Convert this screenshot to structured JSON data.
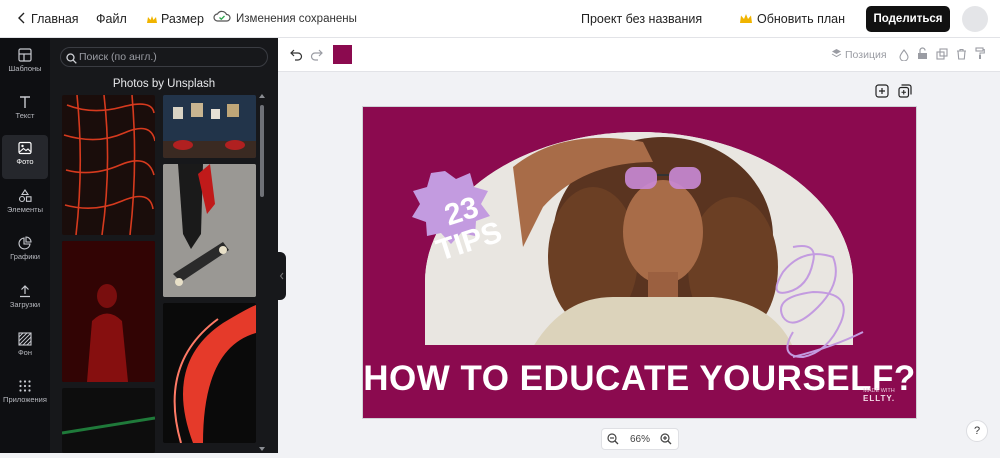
{
  "topbar": {
    "back_label": "Главная",
    "file_label": "Файл",
    "size_label": "Размер",
    "saved_label": "Изменения сохранены",
    "project_title": "Проект без названия",
    "upgrade_label": "Обновить план",
    "share_label": "Поделиться"
  },
  "rail": {
    "items": [
      {
        "label": "Шаблоны",
        "icon": "templates-icon"
      },
      {
        "label": "Текст",
        "icon": "text-icon"
      },
      {
        "label": "Фото",
        "icon": "photo-icon"
      },
      {
        "label": "Элементы",
        "icon": "elements-icon"
      },
      {
        "label": "Графики",
        "icon": "charts-icon"
      },
      {
        "label": "Загрузки",
        "icon": "upload-icon"
      },
      {
        "label": "Фон",
        "icon": "background-icon"
      },
      {
        "label": "Приложения",
        "icon": "apps-icon"
      }
    ],
    "active_index": 2
  },
  "panel": {
    "search_placeholder": "Поиск (по англ.)",
    "title": "Photos by Unsplash"
  },
  "toolbar": {
    "position_label": "Позиция",
    "current_color": "#8b0a4f"
  },
  "canvas": {
    "badge_number": "23",
    "badge_word": "TIPS",
    "headline": "HOW TO EDUCATE YOURSELF?",
    "watermark_top": "MADE WITH",
    "watermark_brand": "ELLTY."
  },
  "zoom": {
    "level": "66%"
  },
  "help": {
    "label": "?"
  },
  "colors": {
    "accent": "#8b0a4f",
    "badge": "#c39be0",
    "arch": "#ffffff",
    "dark_panel": "#17181b"
  }
}
